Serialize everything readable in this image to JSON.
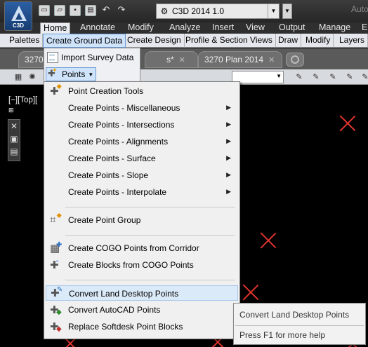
{
  "app": {
    "button_label": "C3D",
    "title_suffix": "Auto"
  },
  "workspace": {
    "label": "C3D 2014 1.0"
  },
  "ribbon_tabs": [
    "Home",
    "Annotate",
    "Modify",
    "Analyze",
    "Insert",
    "View",
    "Output",
    "Manage",
    "E"
  ],
  "ribbon_panels": [
    "Palettes",
    "Create Ground Data",
    "Create Design",
    "Profile & Section Views",
    "Draw",
    "Modify",
    "Layers"
  ],
  "doc_tabs": [
    "3270",
    "s*",
    "3270 Plan 2014"
  ],
  "viewport": {
    "label": "[−][Top]["
  },
  "ground_data_menu": {
    "import_label": "Import Survey Data",
    "points_label": "Points"
  },
  "points_menu": [
    {
      "label": "Point Creation Tools",
      "icon": "point-creation-tools-icon",
      "submenu": false
    },
    {
      "label": "Create Points - Miscellaneous",
      "submenu": true
    },
    {
      "label": "Create Points - Intersections",
      "submenu": true
    },
    {
      "label": "Create Points - Alignments",
      "submenu": true
    },
    {
      "label": "Create Points - Surface",
      "submenu": true
    },
    {
      "label": "Create Points - Slope",
      "submenu": true
    },
    {
      "label": "Create Points - Interpolate",
      "submenu": true
    },
    {
      "label": "Create Point Group",
      "icon": "point-group-icon",
      "submenu": false
    },
    {
      "label": "Create COGO Points from Corridor",
      "icon": "corridor-points-icon",
      "submenu": false
    },
    {
      "label": "Create Blocks from COGO Points",
      "icon": "blocks-from-points-icon",
      "submenu": false
    },
    {
      "label": "Convert Land Desktop Points",
      "icon": "land-desktop-points-icon",
      "submenu": false,
      "highlighted": true
    },
    {
      "label": "Convert AutoCAD Points",
      "icon": "autocad-points-icon",
      "submenu": false
    },
    {
      "label": "Replace Softdesk Point Blocks",
      "icon": "softdesk-blocks-icon",
      "submenu": false
    }
  ],
  "tooltip": {
    "title": "Convert Land Desktop Points",
    "help": "Press F1 for more help"
  },
  "colors": {
    "accent": "#cfe3fa",
    "drawing_marks": "#e0342d"
  }
}
